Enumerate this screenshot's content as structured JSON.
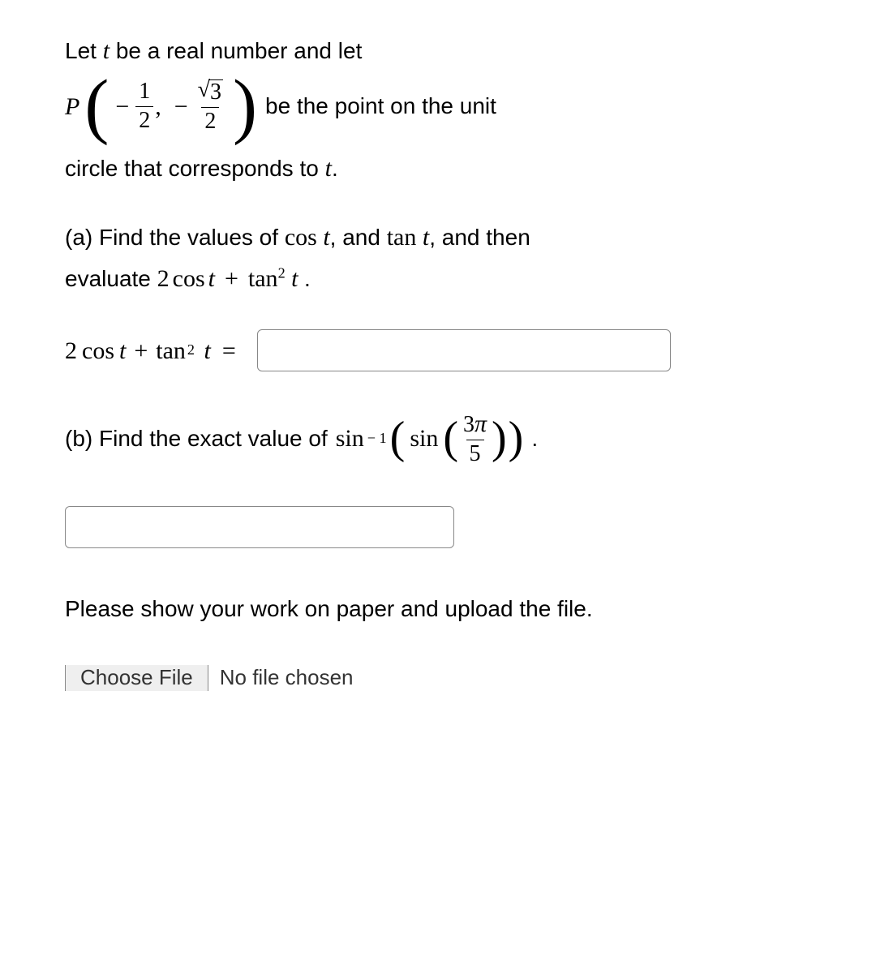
{
  "intro": {
    "line1_pre": "Let ",
    "var_t": "t",
    "line1_post": " be a real number and let",
    "point_P": "P",
    "frac1_num": "1",
    "frac1_den": "2",
    "frac2_num_sqrt": "3",
    "frac2_den": "2",
    "line2_post": "be the point on the unit",
    "line3": "circle that corresponds to ",
    "period": "."
  },
  "partA": {
    "label": "(a) Find the values of ",
    "cos": "cos",
    "tan": "tan",
    "and_then": ", and then",
    "evaluate_pre": "evaluate ",
    "expr_two": "2",
    "expr_plus": "+",
    "sq": "2",
    "period": ".",
    "answer_eq": "="
  },
  "partB": {
    "label": "(b) Find the exact value of ",
    "sin": "sin",
    "neg1": "− 1",
    "frac_num": "3",
    "pi": "π",
    "frac_den": "5",
    "period": "."
  },
  "instruction": "Please show your work on paper and upload the file.",
  "fileUpload": {
    "button": "Choose File",
    "status": "No file chosen"
  },
  "and_word": ", and "
}
